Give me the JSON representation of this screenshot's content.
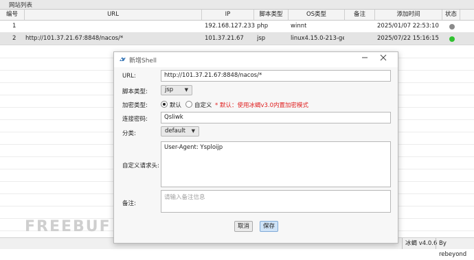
{
  "panel": {
    "title": "网站列表"
  },
  "table": {
    "headers": [
      "编号",
      "URL",
      "IP",
      "脚本类型",
      "OS类型",
      "备注",
      "添加时间",
      "状态"
    ],
    "rows": [
      {
        "id": "1",
        "url": "",
        "ip": "192.168.127.233",
        "script": "php",
        "os": "winnt",
        "note": "",
        "time": "2025/01/07 22:53:10",
        "status_color": "#8a8a8a"
      },
      {
        "id": "2",
        "url": "http://101.37.21.67:8848/nacos/*",
        "ip": "101.37.21.67",
        "script": "jsp",
        "os": "linux4.15.0-213-ge...",
        "note": "",
        "time": "2025/07/22 15:16:15",
        "status_color": "#2fc12f"
      }
    ]
  },
  "dialog": {
    "title": "新增Shell",
    "url_label": "URL:",
    "url_value": "http://101.37.21.67:8848/nacos/*",
    "script_label": "脚本类型:",
    "script_value": "jsp",
    "encrypt_label": "加密类型:",
    "encrypt_default": "默认",
    "encrypt_custom": "自定义",
    "encrypt_hint": "* 默认：使用冰蝎v3.0内置加密模式",
    "password_label": "连接密码:",
    "password_value": "Qsliwk",
    "category_label": "分类:",
    "category_value": "default",
    "headers_label": "自定义请求头:",
    "headers_value": "User-Agent: Ysploijp",
    "remark_label": "备注:",
    "remark_placeholder": "请输入备注信息",
    "cancel_label": "取消",
    "save_label": "保存"
  },
  "statusbar": {
    "version": "冰蝎 v4.0.6",
    "author": "By rebeyond"
  },
  "watermark": "FREEBUF"
}
